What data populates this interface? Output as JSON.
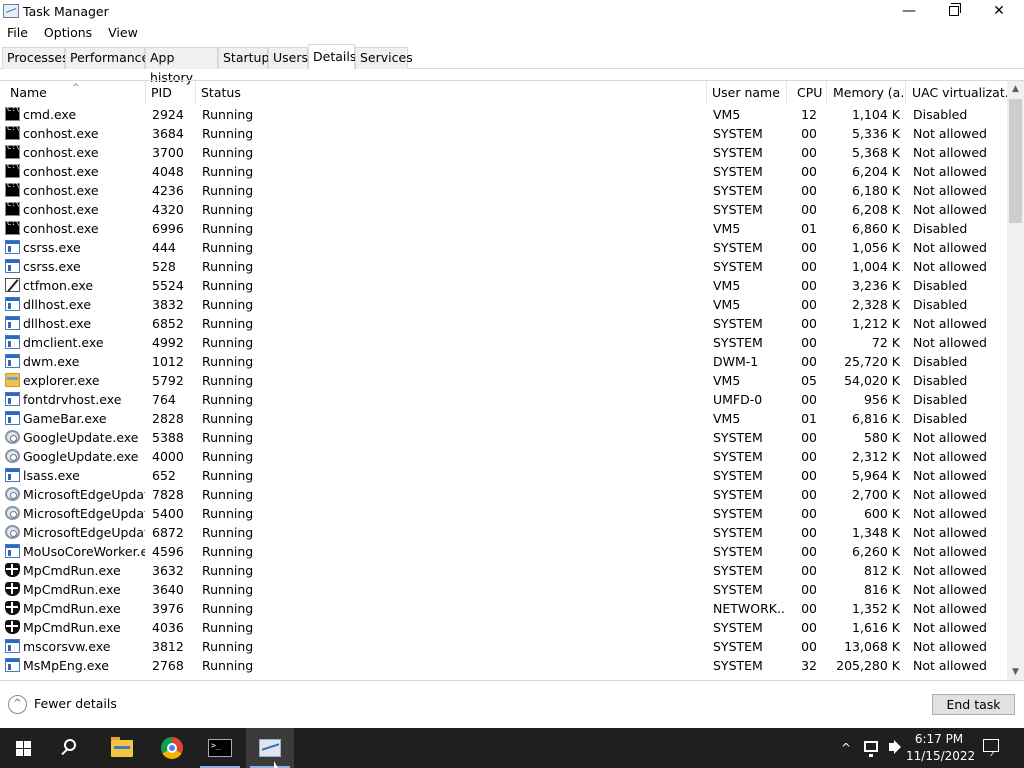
{
  "window": {
    "title": "Task Manager",
    "minimize_symbol": "—",
    "close_symbol": "✕"
  },
  "menu": [
    "File",
    "Options",
    "View"
  ],
  "tabs": [
    {
      "label": "Processes",
      "active": false
    },
    {
      "label": "Performance",
      "active": false
    },
    {
      "label": "App history",
      "active": false
    },
    {
      "label": "Startup",
      "active": false
    },
    {
      "label": "Users",
      "active": false
    },
    {
      "label": "Details",
      "active": true
    },
    {
      "label": "Services",
      "active": false
    }
  ],
  "columns": {
    "name": "Name",
    "pid": "PID",
    "status": "Status",
    "user": "User name",
    "cpu": "CPU",
    "memory": "Memory (a...",
    "uac": "UAC virtualizat..."
  },
  "sort_indicator": "^",
  "rows": [
    {
      "icon": "cmd",
      "name": "cmd.exe",
      "pid": "2924",
      "status": "Running",
      "user": "VM5",
      "cpu": "12",
      "memory": "1,104 K",
      "uac": "Disabled"
    },
    {
      "icon": "cmd",
      "name": "conhost.exe",
      "pid": "3684",
      "status": "Running",
      "user": "SYSTEM",
      "cpu": "00",
      "memory": "5,336 K",
      "uac": "Not allowed"
    },
    {
      "icon": "cmd",
      "name": "conhost.exe",
      "pid": "3700",
      "status": "Running",
      "user": "SYSTEM",
      "cpu": "00",
      "memory": "5,368 K",
      "uac": "Not allowed"
    },
    {
      "icon": "cmd",
      "name": "conhost.exe",
      "pid": "4048",
      "status": "Running",
      "user": "SYSTEM",
      "cpu": "00",
      "memory": "6,204 K",
      "uac": "Not allowed"
    },
    {
      "icon": "cmd",
      "name": "conhost.exe",
      "pid": "4236",
      "status": "Running",
      "user": "SYSTEM",
      "cpu": "00",
      "memory": "6,180 K",
      "uac": "Not allowed"
    },
    {
      "icon": "cmd",
      "name": "conhost.exe",
      "pid": "4320",
      "status": "Running",
      "user": "SYSTEM",
      "cpu": "00",
      "memory": "6,208 K",
      "uac": "Not allowed"
    },
    {
      "icon": "cmd",
      "name": "conhost.exe",
      "pid": "6996",
      "status": "Running",
      "user": "VM5",
      "cpu": "01",
      "memory": "6,860 K",
      "uac": "Disabled"
    },
    {
      "icon": "win",
      "name": "csrss.exe",
      "pid": "444",
      "status": "Running",
      "user": "SYSTEM",
      "cpu": "00",
      "memory": "1,056 K",
      "uac": "Not allowed"
    },
    {
      "icon": "win",
      "name": "csrss.exe",
      "pid": "528",
      "status": "Running",
      "user": "SYSTEM",
      "cpu": "00",
      "memory": "1,004 K",
      "uac": "Not allowed"
    },
    {
      "icon": "pen",
      "name": "ctfmon.exe",
      "pid": "5524",
      "status": "Running",
      "user": "VM5",
      "cpu": "00",
      "memory": "3,236 K",
      "uac": "Disabled"
    },
    {
      "icon": "win",
      "name": "dllhost.exe",
      "pid": "3832",
      "status": "Running",
      "user": "VM5",
      "cpu": "00",
      "memory": "2,328 K",
      "uac": "Disabled"
    },
    {
      "icon": "win",
      "name": "dllhost.exe",
      "pid": "6852",
      "status": "Running",
      "user": "SYSTEM",
      "cpu": "00",
      "memory": "1,212 K",
      "uac": "Not allowed"
    },
    {
      "icon": "win",
      "name": "dmclient.exe",
      "pid": "4992",
      "status": "Running",
      "user": "SYSTEM",
      "cpu": "00",
      "memory": "72 K",
      "uac": "Not allowed"
    },
    {
      "icon": "win",
      "name": "dwm.exe",
      "pid": "1012",
      "status": "Running",
      "user": "DWM-1",
      "cpu": "00",
      "memory": "25,720 K",
      "uac": "Disabled"
    },
    {
      "icon": "folder",
      "name": "explorer.exe",
      "pid": "5792",
      "status": "Running",
      "user": "VM5",
      "cpu": "05",
      "memory": "54,020 K",
      "uac": "Disabled"
    },
    {
      "icon": "win",
      "name": "fontdrvhost.exe",
      "pid": "764",
      "status": "Running",
      "user": "UMFD-0",
      "cpu": "00",
      "memory": "956 K",
      "uac": "Disabled"
    },
    {
      "icon": "win",
      "name": "GameBar.exe",
      "pid": "2828",
      "status": "Running",
      "user": "VM5",
      "cpu": "01",
      "memory": "6,816 K",
      "uac": "Disabled"
    },
    {
      "icon": "gear",
      "name": "GoogleUpdate.exe",
      "pid": "5388",
      "status": "Running",
      "user": "SYSTEM",
      "cpu": "00",
      "memory": "580 K",
      "uac": "Not allowed"
    },
    {
      "icon": "gear",
      "name": "GoogleUpdate.exe",
      "pid": "4000",
      "status": "Running",
      "user": "SYSTEM",
      "cpu": "00",
      "memory": "2,312 K",
      "uac": "Not allowed"
    },
    {
      "icon": "win",
      "name": "lsass.exe",
      "pid": "652",
      "status": "Running",
      "user": "SYSTEM",
      "cpu": "00",
      "memory": "5,964 K",
      "uac": "Not allowed"
    },
    {
      "icon": "gear",
      "name": "MicrosoftEdgeUpdat...",
      "pid": "7828",
      "status": "Running",
      "user": "SYSTEM",
      "cpu": "00",
      "memory": "2,700 K",
      "uac": "Not allowed"
    },
    {
      "icon": "gear",
      "name": "MicrosoftEdgeUpdat...",
      "pid": "5400",
      "status": "Running",
      "user": "SYSTEM",
      "cpu": "00",
      "memory": "600 K",
      "uac": "Not allowed"
    },
    {
      "icon": "gear",
      "name": "MicrosoftEdgeUpdat...",
      "pid": "6872",
      "status": "Running",
      "user": "SYSTEM",
      "cpu": "00",
      "memory": "1,348 K",
      "uac": "Not allowed"
    },
    {
      "icon": "win",
      "name": "MoUsoCoreWorker.e...",
      "pid": "4596",
      "status": "Running",
      "user": "SYSTEM",
      "cpu": "00",
      "memory": "6,260 K",
      "uac": "Not allowed"
    },
    {
      "icon": "shield",
      "name": "MpCmdRun.exe",
      "pid": "3632",
      "status": "Running",
      "user": "SYSTEM",
      "cpu": "00",
      "memory": "812 K",
      "uac": "Not allowed"
    },
    {
      "icon": "shield",
      "name": "MpCmdRun.exe",
      "pid": "3640",
      "status": "Running",
      "user": "SYSTEM",
      "cpu": "00",
      "memory": "816 K",
      "uac": "Not allowed"
    },
    {
      "icon": "shield",
      "name": "MpCmdRun.exe",
      "pid": "3976",
      "status": "Running",
      "user": "NETWORK...",
      "cpu": "00",
      "memory": "1,352 K",
      "uac": "Not allowed"
    },
    {
      "icon": "shield",
      "name": "MpCmdRun.exe",
      "pid": "4036",
      "status": "Running",
      "user": "SYSTEM",
      "cpu": "00",
      "memory": "1,616 K",
      "uac": "Not allowed"
    },
    {
      "icon": "win",
      "name": "mscorsvw.exe",
      "pid": "3812",
      "status": "Running",
      "user": "SYSTEM",
      "cpu": "00",
      "memory": "13,068 K",
      "uac": "Not allowed"
    },
    {
      "icon": "win",
      "name": "MsMpEng.exe",
      "pid": "2768",
      "status": "Running",
      "user": "SYSTEM",
      "cpu": "32",
      "memory": "205,280 K",
      "uac": "Not allowed"
    }
  ],
  "scrollbar": {
    "up_arrow": "▲",
    "down_arrow": "▼"
  },
  "footer": {
    "fewer_details": "Fewer details",
    "fewer_icon": "^",
    "end_task": "End task"
  },
  "taskbar": {
    "chevron": "^",
    "time": "6:17 PM",
    "date": "11/15/2022"
  }
}
